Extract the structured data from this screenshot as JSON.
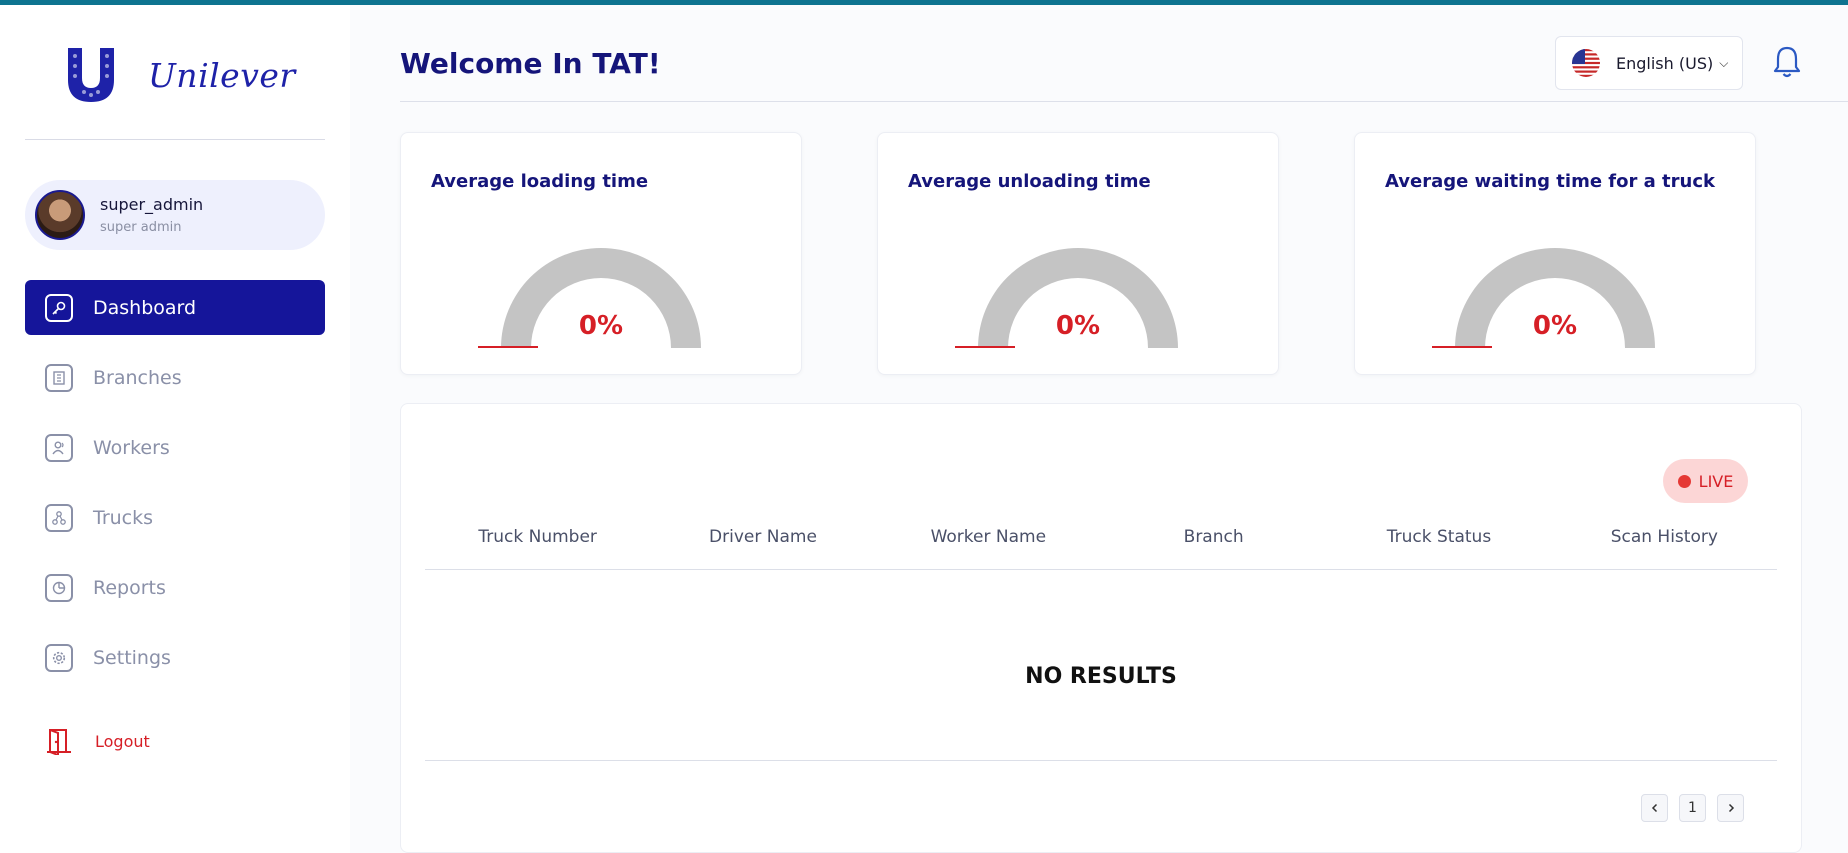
{
  "brand": {
    "name": "Unilever",
    "accent": "#15159a",
    "danger": "#d61f26"
  },
  "user": {
    "name": "super_admin",
    "role": "super admin"
  },
  "sidebar": {
    "items": [
      {
        "label": "Dashboard",
        "icon": "key-icon",
        "active": true
      },
      {
        "label": "Branches",
        "icon": "building-icon"
      },
      {
        "label": "Workers",
        "icon": "users-icon"
      },
      {
        "label": "Trucks",
        "icon": "network-icon"
      },
      {
        "label": "Reports",
        "icon": "pie-chart-icon"
      },
      {
        "label": "Settings",
        "icon": "gear-icon"
      }
    ],
    "logout_label": "Logout"
  },
  "header": {
    "title": "Welcome In TAT!",
    "language": "English (US)"
  },
  "cards": [
    {
      "title": "Average loading time",
      "value": "0%"
    },
    {
      "title": "Average unloading time",
      "value": "0%"
    },
    {
      "title": "Average waiting time for a truck",
      "value": "0%"
    }
  ],
  "table": {
    "live_label": "LIVE",
    "columns": [
      "Truck Number",
      "Driver Name",
      "Worker Name",
      "Branch",
      "Truck Status",
      "Scan History"
    ],
    "empty_text": "NO RESULTS",
    "page": "1"
  }
}
